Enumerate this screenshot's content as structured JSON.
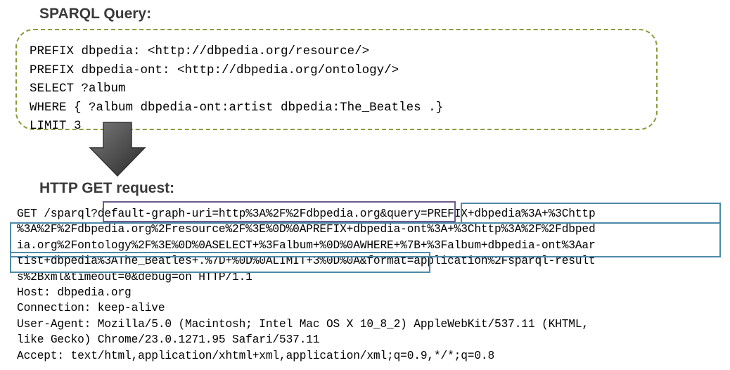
{
  "sparql_section": {
    "heading": "SPARQL Query:",
    "lines": [
      "PREFIX dbpedia: <http://dbpedia.org/resource/>",
      "PREFIX dbpedia-ont: <http://dbpedia.org/ontology/>",
      "SELECT ?album",
      "WHERE { ?album dbpedia-ont:artist dbpedia:The_Beatles .}",
      "LIMIT 3"
    ],
    "border_color": "#8c9a3c"
  },
  "arrow": {
    "direction": "down",
    "color": "#4a4a4a"
  },
  "http_section": {
    "heading": "HTTP GET request:",
    "request_line": {
      "prefix": "GET /sparql",
      "graph_param": "?default-graph-uri=http%3A%2F%2Fdbpedia.org",
      "amp": "&",
      "query_part1": "query=PREFIX+dbpedia%3A+%3Chttp",
      "query_part2": "%3A%2F%2Fdbpedia.org%2Fresource%2F%3E%0D%0APREFIX+dbpedia-ont%3A+%3Chttp%3A%2F%2Fdbped",
      "query_part3": "ia.org%2Fontology%2F%3E%0D%0ASELECT+%3Falbum+%0D%0AWHERE+%7B+%3Falbum+dbpedia-ont%3Aar",
      "query_part4": "tist+dbpedia%3AThe_Beatles+.%7D+%0D%0ALIMIT+3%0D%0A",
      "rest4": "&format=application%2Fsparql-result",
      "line5": "s%2Bxml&timeout=0&debug=on HTTP/1.1"
    },
    "headers": [
      "Host: dbpedia.org",
      "Connection: keep-alive",
      "User-Agent: Mozilla/5.0 (Macintosh; Intel Mac OS X 10_8_2) AppleWebKit/537.11 (KHTML,",
      "like Gecko) Chrome/23.0.1271.95 Safari/537.11",
      "Accept: text/html,application/xhtml+xml,application/xml;q=0.9,*/*;q=0.8"
    ],
    "graph_highlight_color": "#6d5a8e",
    "query_highlight_color": "#4e8aa8"
  }
}
